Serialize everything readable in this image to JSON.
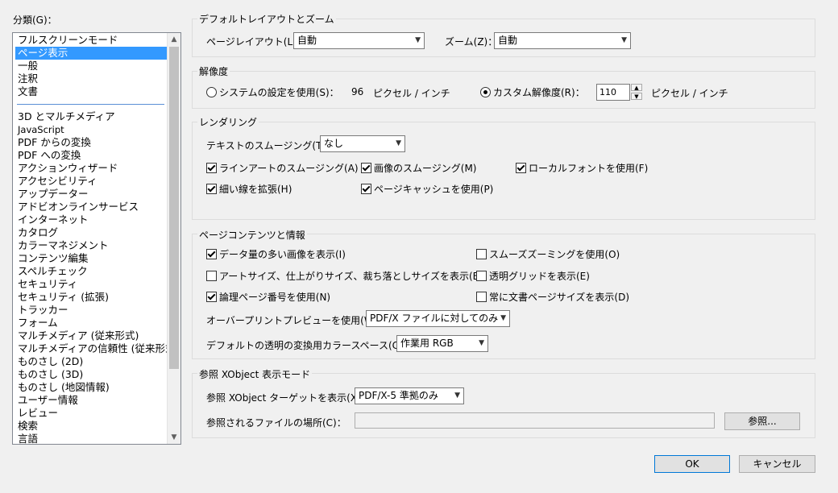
{
  "categories_label": "分類(G)：",
  "categories": [
    "フルスクリーンモード",
    "ページ表示",
    "一般",
    "注釈",
    "文書",
    "3D とマルチメディア",
    "JavaScript",
    "PDF からの変換",
    "PDF への変換",
    "アクションウィザード",
    "アクセシビリティ",
    "アップデーター",
    "アドビオンラインサービス",
    "インターネット",
    "カタログ",
    "カラーマネジメント",
    "コンテンツ編集",
    "スペルチェック",
    "セキュリティ",
    "セキュリティ (拡張)",
    "トラッカー",
    "フォーム",
    "マルチメディア (従来形式)",
    "マルチメディアの信頼性 (従来形式)",
    "ものさし (2D)",
    "ものさし (3D)",
    "ものさし (地図情報)",
    "ユーザー情報",
    "レビュー",
    "検索",
    "言語"
  ],
  "selected_category": "ページ表示",
  "layout_zoom": {
    "title": "デフォルトレイアウトとズーム",
    "page_layout_label": "ページレイアウト(L)：",
    "page_layout_value": "自動",
    "zoom_label": "ズーム(Z)：",
    "zoom_value": "自動"
  },
  "resolution": {
    "title": "解像度",
    "system_label": "システムの設定を使用(S)：",
    "system_value": "96",
    "system_unit": "ピクセル / インチ",
    "custom_label": "カスタム解像度(R)：",
    "custom_value": "110",
    "custom_unit": "ピクセル / インチ",
    "selected": "custom"
  },
  "rendering": {
    "title": "レンダリング",
    "text_smoothing_label": "テキストのスムージング(T)：",
    "text_smoothing_value": "なし",
    "lineart_label": "ラインアートのスムージング(A)",
    "image_smoothing_label": "画像のスムージング(M)",
    "local_fonts_label": "ローカルフォントを使用(F)",
    "thin_lines_label": "細い線を拡張(H)",
    "page_cache_label": "ページキャッシュを使用(P)",
    "lineart_checked": true,
    "image_smoothing_checked": true,
    "local_fonts_checked": true,
    "thin_lines_checked": true,
    "page_cache_checked": true
  },
  "page_content": {
    "title": "ページコンテンツと情報",
    "large_images_label": "データ量の多い画像を表示(I)",
    "smooth_zoom_label": "スムーズズーミングを使用(O)",
    "artsize_label": "アートサイズ、仕上がりサイズ、裁ち落としサイズを表示(B)",
    "transparency_grid_label": "透明グリッドを表示(E)",
    "logical_page_label": "論理ページ番号を使用(N)",
    "doc_page_size_label": "常に文書ページサイズを表示(D)",
    "large_images_checked": true,
    "smooth_zoom_checked": false,
    "artsize_checked": false,
    "transparency_grid_checked": false,
    "logical_page_checked": true,
    "doc_page_size_checked": false,
    "overprint_label": "オーバープリントプレビューを使用(W)：",
    "overprint_value": "PDF/X ファイルに対してのみ",
    "blend_space_label": "デフォルトの透明の変換用カラースペース(C)：",
    "blend_space_value": "作業用 RGB"
  },
  "xobject": {
    "title": "参照 XObject 表示モード",
    "target_label": "参照 XObject ターゲットを表示(X)：",
    "target_value": "PDF/X-5 準拠のみ",
    "location_label": "参照されるファイルの場所(C)：",
    "location_value": "",
    "browse_label": "参照..."
  },
  "buttons": {
    "ok": "OK",
    "cancel": "キャンセル"
  }
}
